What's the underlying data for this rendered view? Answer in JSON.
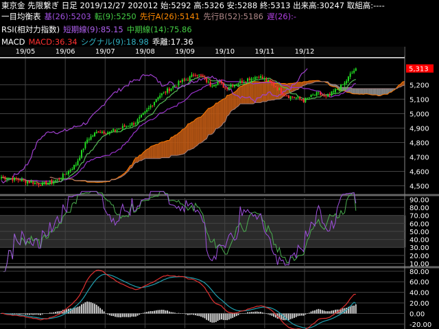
{
  "header": {
    "line1": "東京金 先限繋ぎ 日足 2019/12/27 202012 始:5292 高:5326 安:5288 終:5313 出来高:30247 取組高:----",
    "ichimoku_label": "一目均衡表",
    "kijun": "基(26):5203",
    "tenkan": "転(9):5250",
    "senkou_a": "先行A(26):5141",
    "senkou_b": "先行B(52):5186",
    "chikou": "遅(26):-",
    "rsi_label": "RSI(相対力指数)",
    "rsi_short": "短期線(9):85.15",
    "rsi_mid": "中期線(14):75.86",
    "macd_label": "MACD",
    "macd_value": "MACD:36.34",
    "signal_value": "シグナル(9):18.98",
    "divergence": "乖離:17.36"
  },
  "colors": {
    "background": "#000000",
    "grid": "#444444",
    "up_candle": "#22dd22",
    "down_candle": "#ff3030",
    "kijun": "#9933cc",
    "tenkan": "#55bb55",
    "senkou_a": "#ff7a00",
    "senkou_b": "#a08080",
    "chikou": "#a040d0",
    "cloud_bull": "#c05a14",
    "cloud_bear": "#909090",
    "rsi_short": "#a050e0",
    "rsi_mid": "#4caf50",
    "macd": "#e03030",
    "signal": "#20a0b0",
    "histogram": "#dddddd",
    "price_tag": "#ff0000"
  },
  "chart_data": [
    {
      "type": "candlestick",
      "title": "",
      "x_ticks": [
        "19/05",
        "19/06",
        "19/07",
        "19/08",
        "19/09",
        "19/10",
        "19/11",
        "19/12"
      ],
      "y_ticks": [
        "4,500",
        "4,600",
        "4,700",
        "4,800",
        "4,900",
        "5,000",
        "5,100",
        "5,200"
      ],
      "ylim": [
        4450,
        5340
      ],
      "last_price_label": "5,313",
      "last_price": 5313,
      "close_anchors": [
        [
          0,
          4560
        ],
        [
          10,
          4540
        ],
        [
          22,
          4510
        ],
        [
          30,
          4540
        ],
        [
          36,
          4600
        ],
        [
          40,
          4650
        ],
        [
          46,
          4820
        ],
        [
          52,
          4880
        ],
        [
          58,
          4870
        ],
        [
          64,
          4900
        ],
        [
          72,
          4940
        ],
        [
          78,
          5020
        ],
        [
          84,
          5120
        ],
        [
          90,
          5170
        ],
        [
          96,
          5220
        ],
        [
          100,
          5240
        ],
        [
          104,
          5280
        ],
        [
          108,
          5250
        ],
        [
          112,
          5200
        ],
        [
          116,
          5220
        ],
        [
          120,
          5180
        ],
        [
          126,
          5210
        ],
        [
          132,
          5240
        ],
        [
          138,
          5260
        ],
        [
          142,
          5230
        ],
        [
          146,
          5200
        ],
        [
          150,
          5150
        ],
        [
          154,
          5120
        ],
        [
          158,
          5110
        ],
        [
          162,
          5090
        ],
        [
          166,
          5120
        ],
        [
          170,
          5140
        ],
        [
          174,
          5110
        ],
        [
          178,
          5150
        ],
        [
          181,
          5180
        ],
        [
          184,
          5210
        ],
        [
          187,
          5270
        ],
        [
          190,
          5313
        ]
      ],
      "future_cloud_bars": 26,
      "grid": true
    },
    {
      "type": "line",
      "title": "",
      "y_ticks": [
        "10.00",
        "20.00",
        "30.00",
        "40.00",
        "50.00",
        "60.00",
        "70.00",
        "80.00",
        "90.00"
      ],
      "ylim": [
        7,
        92
      ],
      "bands": [
        [
          30,
          70
        ]
      ],
      "series": [
        {
          "name": "短期線(9)",
          "last": 85.15
        },
        {
          "name": "中期線(14)",
          "last": 75.86
        }
      ],
      "grid": true
    },
    {
      "type": "line",
      "title": "",
      "y_ticks": [
        "-20.00",
        "0.00",
        "20.00",
        "40.00",
        "60.00",
        "80.00"
      ],
      "ylim": [
        -28,
        85
      ],
      "series": [
        {
          "name": "MACD",
          "last": 36.34
        },
        {
          "name": "シグナル(9)",
          "last": 18.98
        },
        {
          "name": "乖離",
          "last": 17.36
        }
      ],
      "grid": true
    }
  ]
}
